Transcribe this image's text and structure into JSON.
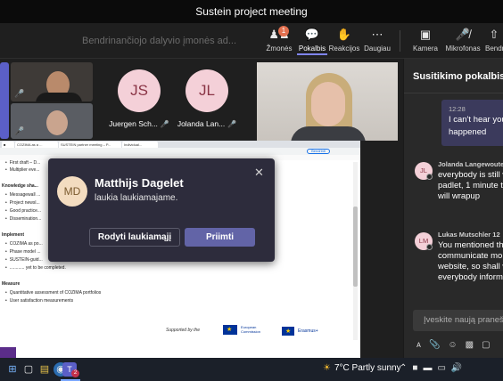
{
  "window": {
    "title": "Sustein project meeting"
  },
  "toolbar": {
    "share_banner": "Bendrinančiojo dalyvio įmonės ad...",
    "people": {
      "label": "Žmonės",
      "icon": "people-icon",
      "badge": "1"
    },
    "chat": {
      "label": "Pokalbis",
      "icon": "chat-icon"
    },
    "reactions": {
      "label": "Reakcijos",
      "icon": "reactions-icon"
    },
    "more": {
      "label": "Daugiau",
      "icon": "more-icon"
    },
    "camera": {
      "label": "Kamera",
      "icon": "camera-icon"
    },
    "mic": {
      "label": "Mikrofonas",
      "icon": "mic-off-icon"
    },
    "share": {
      "label": "Bendrin",
      "icon": "share-icon"
    }
  },
  "participants": [
    {
      "initials": "JS",
      "name": "Juergen Sch...",
      "muted": true
    },
    {
      "initials": "JL",
      "name": "Jolanda Lan...",
      "muted": true
    }
  ],
  "shared_screen": {
    "browser_tabs": [
      "COZIMA as a ...",
      "SUSTEIN partner meeting – P...",
      "Individual..."
    ],
    "share_pill": "Bendrinti",
    "doc_lines": [
      {
        "text": "First draft – D...",
        "type": "bullet"
      },
      {
        "text": "Multiplier eve...",
        "type": "bullet"
      },
      {
        "text": "Knowledge sha...",
        "type": "head"
      },
      {
        "text": "Messagewall ...",
        "type": "bullet"
      },
      {
        "text": "Project newsl...",
        "type": "bullet"
      },
      {
        "text": "Good practice...",
        "type": "bullet"
      },
      {
        "text": "Dissemination...",
        "type": "bullet"
      },
      {
        "text": "Implement",
        "type": "head"
      },
      {
        "text": "COZIMA as po...",
        "type": "bullet"
      },
      {
        "text": "Phase model ...",
        "type": "bullet"
      },
      {
        "text": "SUSTEIN-guid...",
        "type": "bullet"
      },
      {
        "text": "............ yet to be completed.",
        "type": "bullet"
      },
      {
        "text": "Measure",
        "type": "head"
      },
      {
        "text": "Quantitative assessment of COZIMA portfolios",
        "type": "bullet"
      },
      {
        "text": "User satisfaction measurements",
        "type": "bullet"
      }
    ],
    "supported_by": "Supported by the",
    "eu_logo_text": "European Commission",
    "erasmus_text": "Erasmus+"
  },
  "lobby": {
    "initials": "MD",
    "name": "Matthijs Dagelet",
    "status": "laukia laukiamajame.",
    "view_lobby": "Rodyti laukiamąjį",
    "admit": "Priimti"
  },
  "chat_panel": {
    "title": "Susitikimo pokalbis",
    "my_message": {
      "time": "12:28",
      "text_line1": "I can't hear you",
      "text_line2": "happened"
    },
    "messages": [
      {
        "initials": "JL",
        "author": "Jolanda Langewoute...",
        "lines": [
          "everybody is still w",
          "padlet, 1 minute th",
          "will wrapup"
        ]
      },
      {
        "initials": "LM",
        "author": "Lukas Mutschler  12",
        "lines": [
          "You mentioned tha",
          "communicate mor",
          "website, so shall w",
          "everybody informe"
        ]
      }
    ],
    "compose_placeholder": "Įveskite naują pranešim..."
  },
  "taskbar": {
    "temperature": "7°C",
    "weather": "Partly sunny",
    "teams_badge": "2"
  },
  "colors": {
    "accent": "#6264a7",
    "avatar_bg": "#f4d0d8",
    "people_badge": "#e3704f"
  }
}
